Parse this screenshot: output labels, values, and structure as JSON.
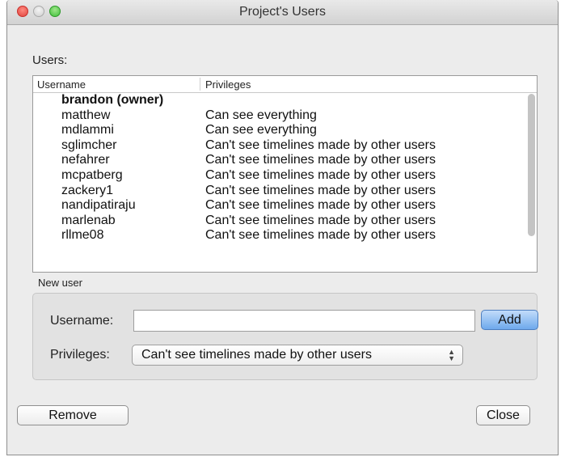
{
  "window": {
    "title": "Project's Users"
  },
  "users_label": "Users:",
  "table": {
    "columns": [
      "Username",
      "Privileges"
    ],
    "rows": [
      {
        "username": "brandon (owner)",
        "privileges": ""
      },
      {
        "username": "matthew",
        "privileges": "Can see everything"
      },
      {
        "username": "mdlammi",
        "privileges": "Can see everything"
      },
      {
        "username": "sglimcher",
        "privileges": "Can't see timelines made by other users"
      },
      {
        "username": "nefahrer",
        "privileges": "Can't see timelines made by other users"
      },
      {
        "username": "mcpatberg",
        "privileges": "Can't see timelines made by other users"
      },
      {
        "username": "zackery1",
        "privileges": "Can't see timelines made by other users"
      },
      {
        "username": "nandipatiraju",
        "privileges": "Can't see timelines made by other users"
      },
      {
        "username": "marlenab",
        "privileges": "Can't see timelines made by other users"
      },
      {
        "username": "rllme08",
        "privileges": "Can't see timelines made by other users"
      }
    ]
  },
  "new_user": {
    "group_label": "New user",
    "username_label": "Username:",
    "username_value": "",
    "add_label": "Add",
    "privileges_label": "Privileges:",
    "privileges_selected": "Can't see timelines made by other users"
  },
  "footer": {
    "remove_label": "Remove",
    "close_label": "Close"
  },
  "colors": {
    "add_button": "#6ea9ec",
    "close_light": "#e0443e",
    "max_light": "#3fbf3a"
  }
}
